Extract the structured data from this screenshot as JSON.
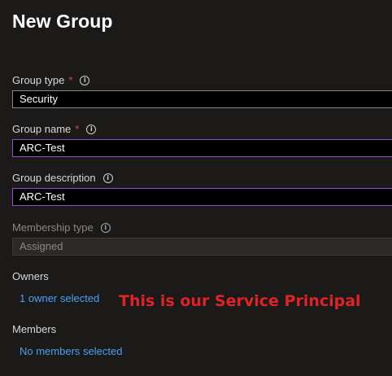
{
  "header": {
    "title": "New Group"
  },
  "form": {
    "group_type": {
      "label": "Group type",
      "required_mark": "*",
      "value": "Security"
    },
    "group_name": {
      "label": "Group name",
      "required_mark": "*",
      "value": "ARC-Test"
    },
    "group_description": {
      "label": "Group description",
      "value": "ARC-Test"
    },
    "membership_type": {
      "label": "Membership type",
      "value": "Assigned",
      "disabled": true
    },
    "owners": {
      "label": "Owners",
      "link": "1 owner selected"
    },
    "members": {
      "label": "Members",
      "link": "No members selected"
    }
  },
  "annotation": {
    "text": "This is our Service Principal",
    "color": "#e02424"
  },
  "colors": {
    "background": "#1b1a19",
    "link": "#4aa0f2",
    "required": "#e0454d",
    "focus_border": "#8f4fd0"
  }
}
